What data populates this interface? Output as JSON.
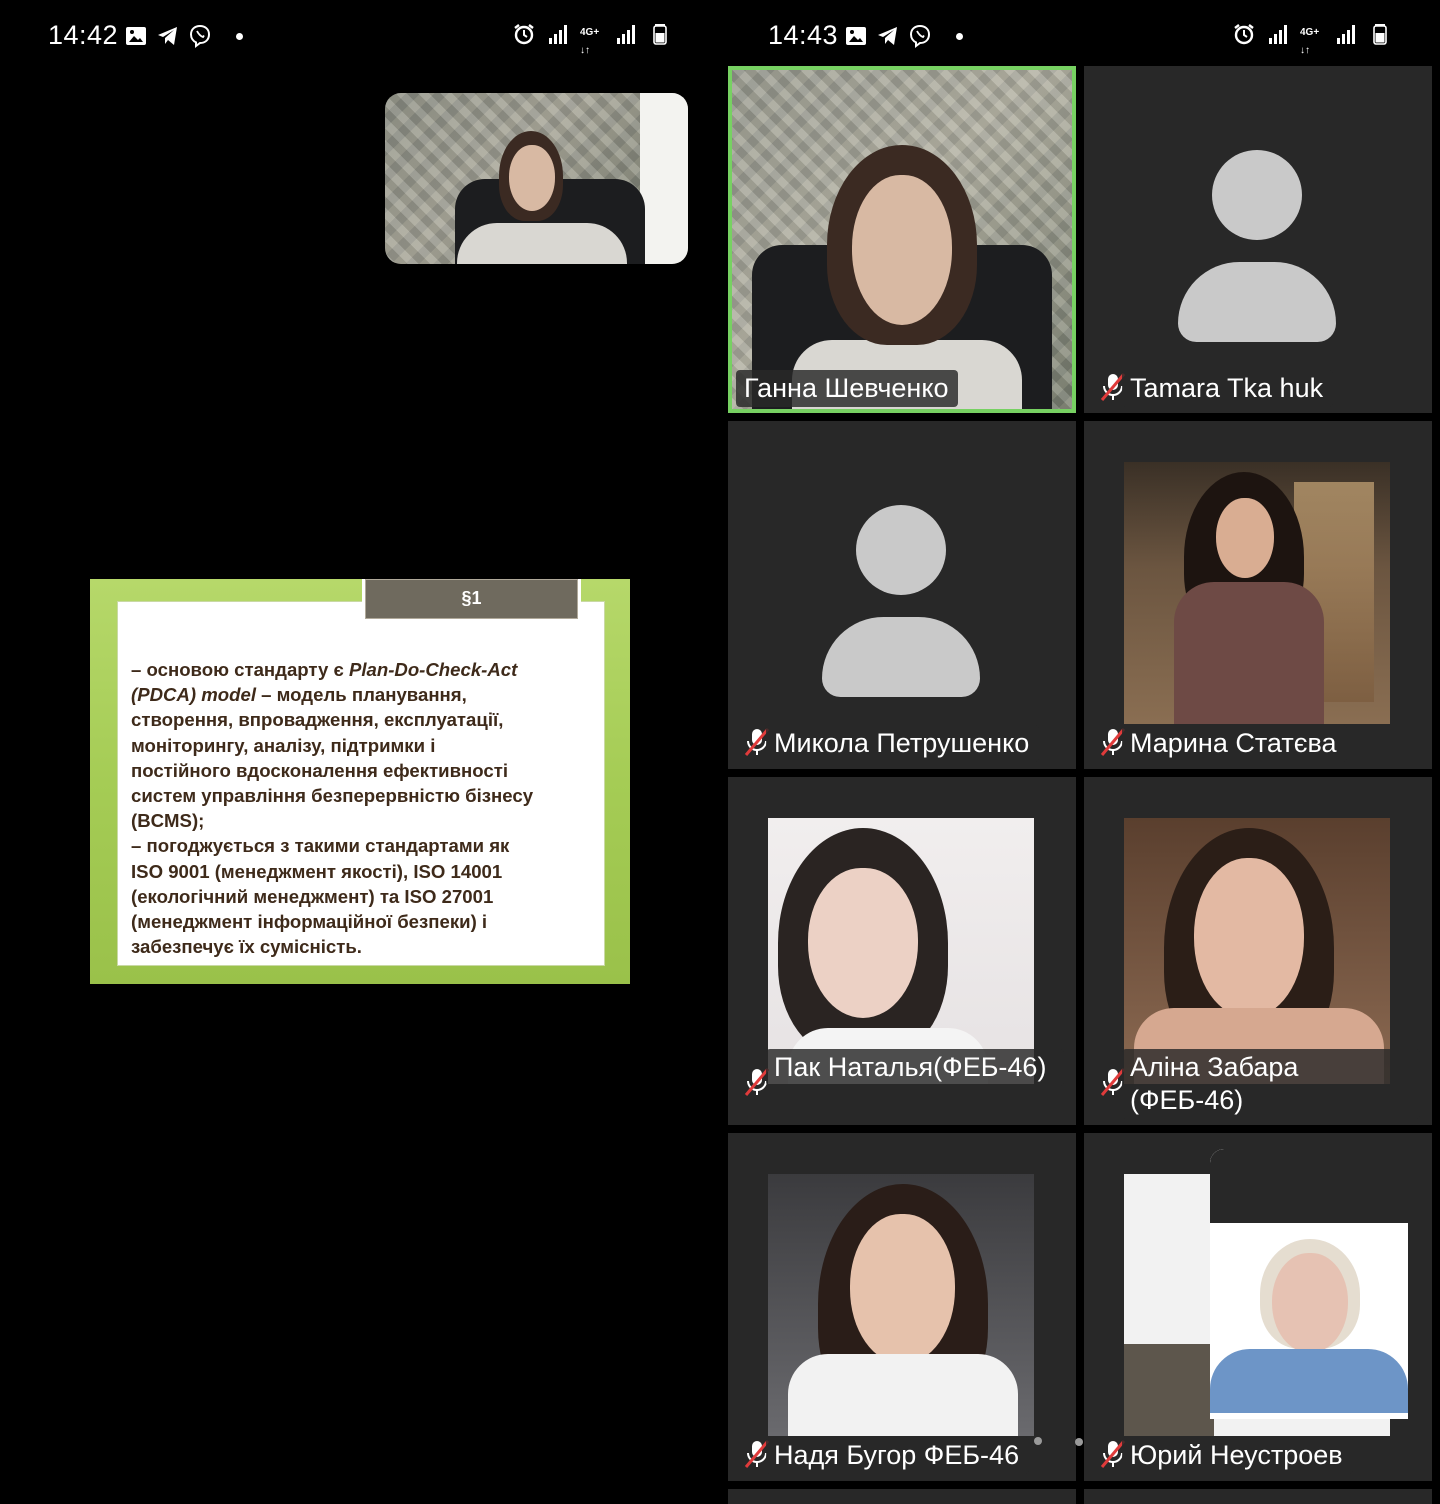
{
  "left_screen": {
    "status_bar": {
      "time": "14:42"
    },
    "slide": {
      "tab_label": "§1",
      "lines": [
        {
          "prefix": "– основою стандарту є ",
          "italic": "Plan-Do-Check-Act",
          "suffix": ""
        },
        {
          "prefix": "",
          "italic": "(PDCA) model",
          "suffix": " – модель планування,"
        },
        {
          "prefix": "створення, впровадження, експлуатації,",
          "italic": "",
          "suffix": ""
        },
        {
          "prefix": "моніторингу, аналізу, підтримки і",
          "italic": "",
          "suffix": ""
        },
        {
          "prefix": "постійного вдосконалення ефективності",
          "italic": "",
          "suffix": ""
        },
        {
          "prefix": "систем управління безперервністю бізнесу",
          "italic": "",
          "suffix": ""
        },
        {
          "prefix": "(BCMS);",
          "italic": "",
          "suffix": ""
        },
        {
          "prefix": "– погоджується з такими стандартами як",
          "italic": "",
          "suffix": ""
        },
        {
          "prefix": "ISO 9001 (менеджмент якості), ISO 14001",
          "italic": "",
          "suffix": ""
        },
        {
          "prefix": "(екологічний менеджмент) та ISO 27001",
          "italic": "",
          "suffix": ""
        },
        {
          "prefix": "(менеджмент інформаційної безпеки) і",
          "italic": "",
          "suffix": ""
        },
        {
          "prefix": "забезпечує їх сумісність.",
          "italic": "",
          "suffix": ""
        }
      ]
    }
  },
  "right_screen": {
    "status_bar": {
      "time": "14:43"
    },
    "participants": [
      {
        "name": "Ганна Шевченко",
        "muted": false,
        "active": true
      },
      {
        "name": "Tamara Tka huk",
        "muted": true,
        "active": false
      },
      {
        "name": "Микола Петрушенко",
        "muted": true,
        "active": false
      },
      {
        "name": "Марина Статєва",
        "muted": true,
        "active": false
      },
      {
        "name": "Пак Наталья(ФЕБ-46)",
        "muted": true,
        "active": false
      },
      {
        "name": "Аліна Забара (ФЕБ-46)",
        "muted": true,
        "active": false
      },
      {
        "name": "Надя Бугор ФЕБ-46",
        "muted": true,
        "active": false
      },
      {
        "name": "Юрий Неустроев",
        "muted": true,
        "active": false
      }
    ]
  },
  "colors": {
    "active_speaker_border": "#77d162",
    "tile_bg": "#282828",
    "slide_green": "#a5cc55",
    "slide_tab": "#6f6a5e",
    "slide_text": "#3e2a1a",
    "avatar_gray": "#c9c9c9"
  },
  "icons": {
    "status_left": [
      "image-icon",
      "telegram-icon",
      "viber-icon"
    ],
    "status_right": [
      "alarm-icon",
      "signal-icon",
      "4g-data-icon",
      "signal-icon",
      "battery-icon"
    ],
    "tile": "mic-off-icon"
  }
}
